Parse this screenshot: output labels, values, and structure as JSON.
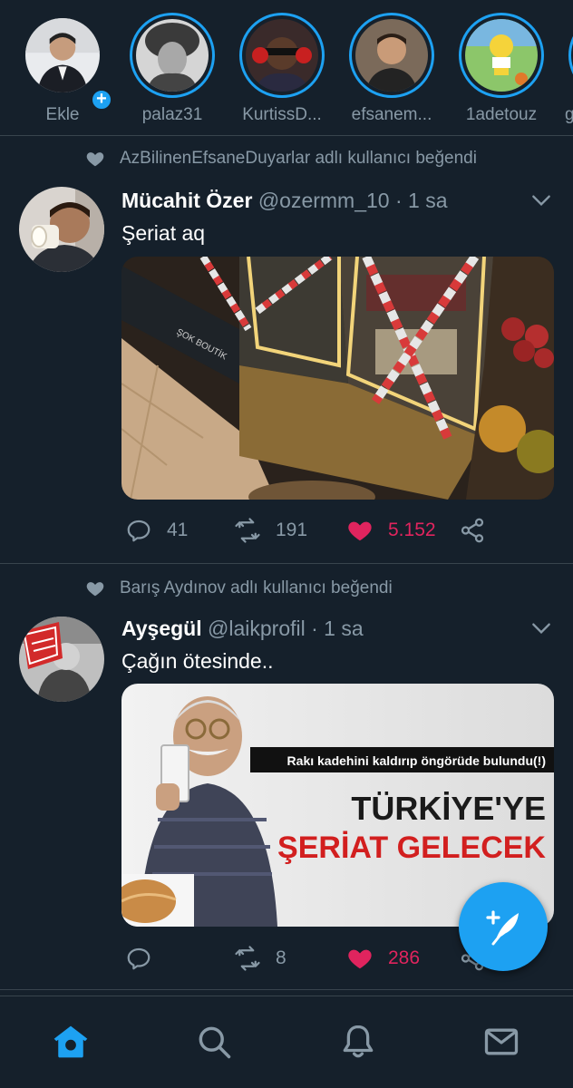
{
  "fleets": [
    {
      "name": "Ekle",
      "is_own": true
    },
    {
      "name": "palaz31"
    },
    {
      "name": "KurtissD..."
    },
    {
      "name": "efsanem..."
    },
    {
      "name": "1adetouz"
    },
    {
      "name": "g"
    }
  ],
  "tweets": [
    {
      "social_context": "AzBilinenEfsaneDuyarlar adlı kullanıcı beğendi",
      "display_name": "Mücahit Özer",
      "handle": "@ozermm_10",
      "time": " · 1 sa",
      "text": "Şeriat aq",
      "replies": "41",
      "retweets": "191",
      "likes": "5.152",
      "liked": true
    },
    {
      "social_context": "Barış Aydınov adlı kullanıcı beğendi",
      "display_name": "Ayşegül",
      "handle": "@laikprofil",
      "time": " · 1 sa",
      "text": "Çağın ötesinde..",
      "replies": "",
      "retweets": "8",
      "likes": "286",
      "liked": true,
      "image_text": {
        "banner": "Rakı kadehini kaldırıp öngörüde bulundu(!)",
        "headline_1": "TÜRKİYE'YE",
        "headline_2": "ŞERİAT GELECEK"
      }
    }
  ],
  "colors": {
    "background": "#15202b",
    "accent": "#1da1f2",
    "like": "#e0245e",
    "secondary_text": "#8899a6",
    "divider": "#38444d"
  },
  "nav": [
    "home-icon",
    "search-icon",
    "notifications-icon",
    "messages-icon"
  ]
}
